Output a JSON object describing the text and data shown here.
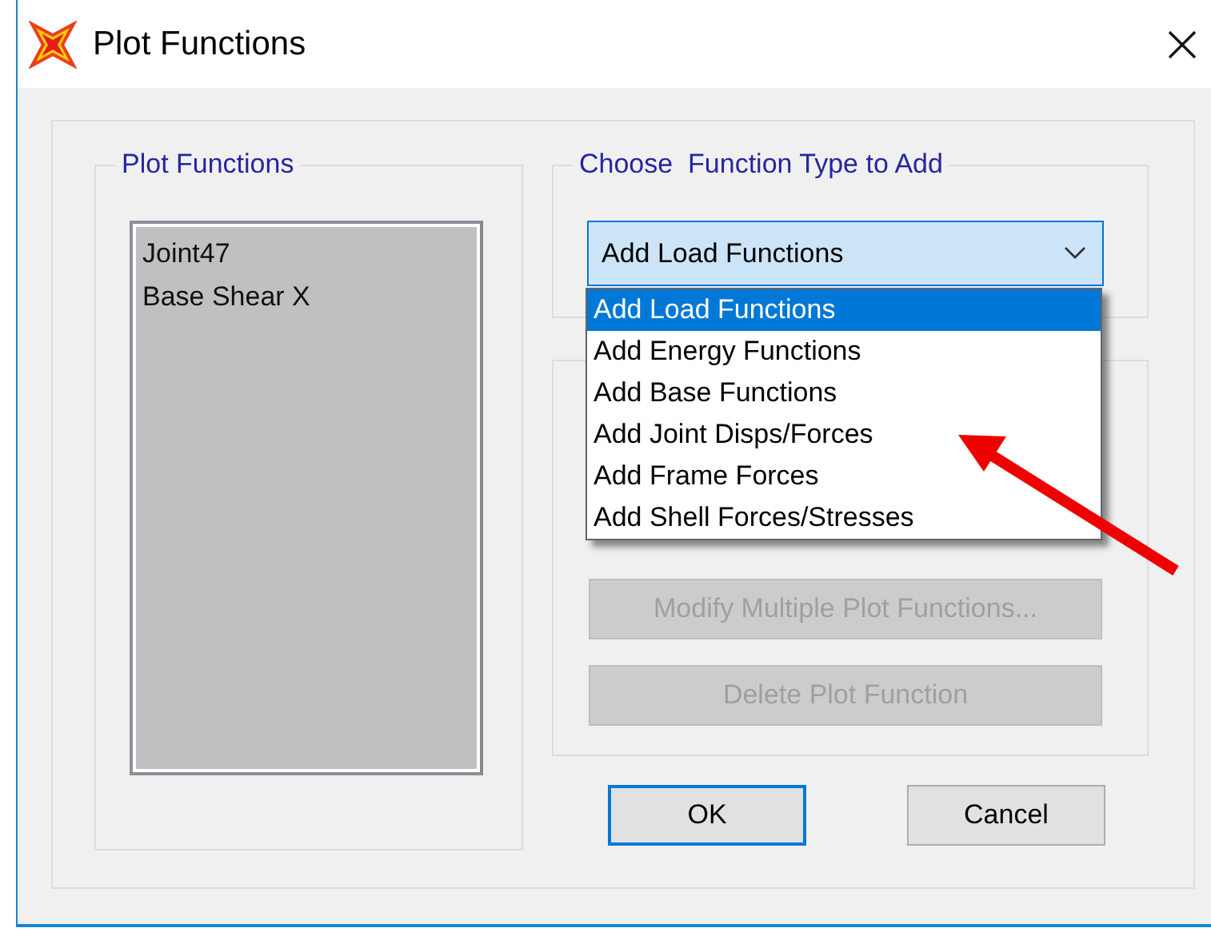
{
  "window": {
    "title": "Plot Functions"
  },
  "plot_functions": {
    "title": "Plot Functions",
    "items": [
      "Joint47",
      "Base Shear X"
    ]
  },
  "function_type": {
    "title": "Choose  Function Type to Add",
    "value": "Add Load Functions",
    "expanded": true,
    "options": [
      {
        "label": "Add Load Functions",
        "selected": true
      },
      {
        "label": "Add Energy Functions",
        "selected": false
      },
      {
        "label": "Add Base Functions",
        "selected": false
      },
      {
        "label": "Add Joint Disps/Forces",
        "selected": false
      },
      {
        "label": "Add Frame Forces",
        "selected": false
      },
      {
        "label": "Add Shell Forces/Stresses",
        "selected": false
      }
    ]
  },
  "buttons": [
    {
      "label": "Modify Multiple Plot Functions...",
      "disabled": true
    },
    {
      "label": "Delete Plot Function",
      "disabled": true
    }
  ],
  "dialog_buttons": [
    {
      "label": "OK",
      "default": true
    },
    {
      "label": "Cancel",
      "default": false
    }
  ]
}
